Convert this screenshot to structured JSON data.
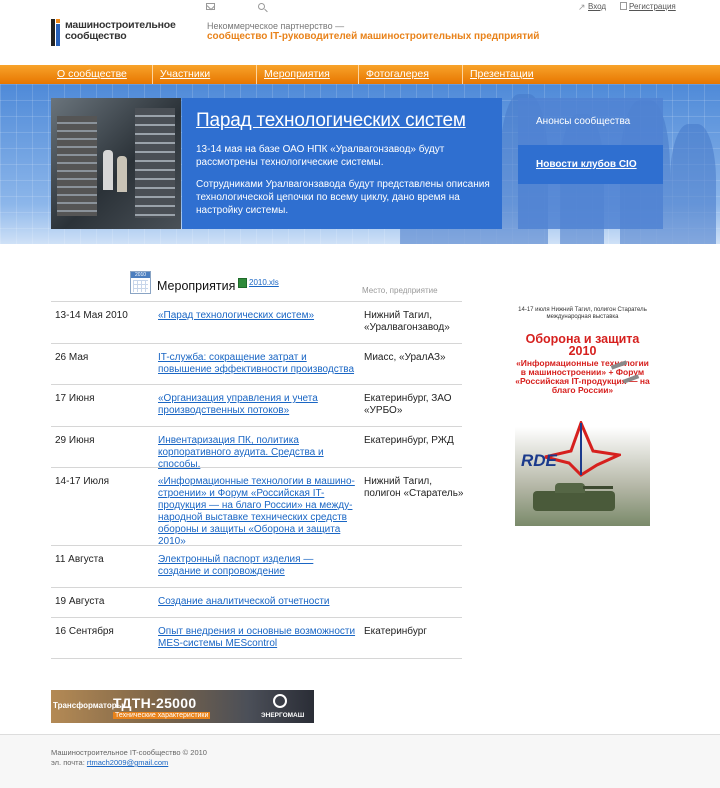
{
  "header": {
    "login": "Вход",
    "register": "Регистрация",
    "logo_line1": "машиностроительное",
    "logo_line2": "сообщество",
    "tagline1": "Некоммерческое партнерство —",
    "tagline2": "сообщество IT-руководителей машиностроительных предприятий"
  },
  "nav": [
    "О сообществе",
    "Участники",
    "Мероприятия",
    "Фотогалерея",
    "Презентации"
  ],
  "banner": {
    "title": "Парад технологических систем",
    "p1": "13-14 мая на базе ОАО НПК «Уралвагонзавод» будут рассмотрены технологические системы.",
    "p2": "Сотрудниками Уралвагонзавода будут представлены описания технологической цепочки по всему циклу, дано время на настройку системы.",
    "side_anons": "Анонсы сообщества",
    "side_news": "Новости клубов CIO"
  },
  "events": {
    "calendar_year": "2010",
    "heading": "Мероприятия",
    "xls_link": "2010.xls",
    "place_header": "Место, предприятие",
    "rows": [
      {
        "date": "13-14 Мая 2010",
        "title": "«Парад технологических систем»",
        "place": "Нижний Тагил, «Уралвагонзавод»"
      },
      {
        "date": "26 Мая",
        "title": "IT-служба: сокращение затрат и повышение эффективности производства",
        "place": "Миасс, «УралАЗ»"
      },
      {
        "date": "17 Июня",
        "title": "«Организация управления и учета производственных потоков»",
        "place": "Екатеринбург, ЗАО «УРБО»"
      },
      {
        "date": "29 Июня",
        "title": "Инвентаризация ПК, политика корпоративного аудита. Средства и способы.",
        "place": "Екатеринбург, РЖД"
      },
      {
        "date": "14-17 Июля",
        "title": "«Информационные технологии в машино-строении» и Форум «Российская IT-продукция — на благо России» на между-народной выставке технических средств обороны и защиты «Оборона и защита 2010»",
        "place": "Нижний Тагил, полигон «Старатель»"
      },
      {
        "date": "11 Августа",
        "title": "Электронный паспорт изделия — создание и сопровождение",
        "place": ""
      },
      {
        "date": "19 Августа",
        "title": "Создание аналитической отчетности",
        "place": ""
      },
      {
        "date": "16 Сентября",
        "title": "Опыт внедрения и основные возможности MES-системы MEScontrol",
        "place": "Екатеринбург"
      }
    ]
  },
  "ad": {
    "small": "14-17 июля Нижний Тагил, полигон Старатель международная выставка",
    "headline": "Оборона и защита 2010",
    "sub": "«Информационные технологии в машиностроении» + Форум «Российская IT-продукция — на благо России»",
    "brand": "RDE"
  },
  "bottom_banner": {
    "prefix": "Трансформаторы",
    "model": "ТДТН-25000",
    "spec": "Технические характеристики",
    "brand": "ЭНЕРГОМАШ"
  },
  "footer": {
    "copyright": "Машиностроительное IT-сообщество © 2010",
    "email_label": "эл. почта:",
    "email": "rtmach2009@gmail.com"
  }
}
